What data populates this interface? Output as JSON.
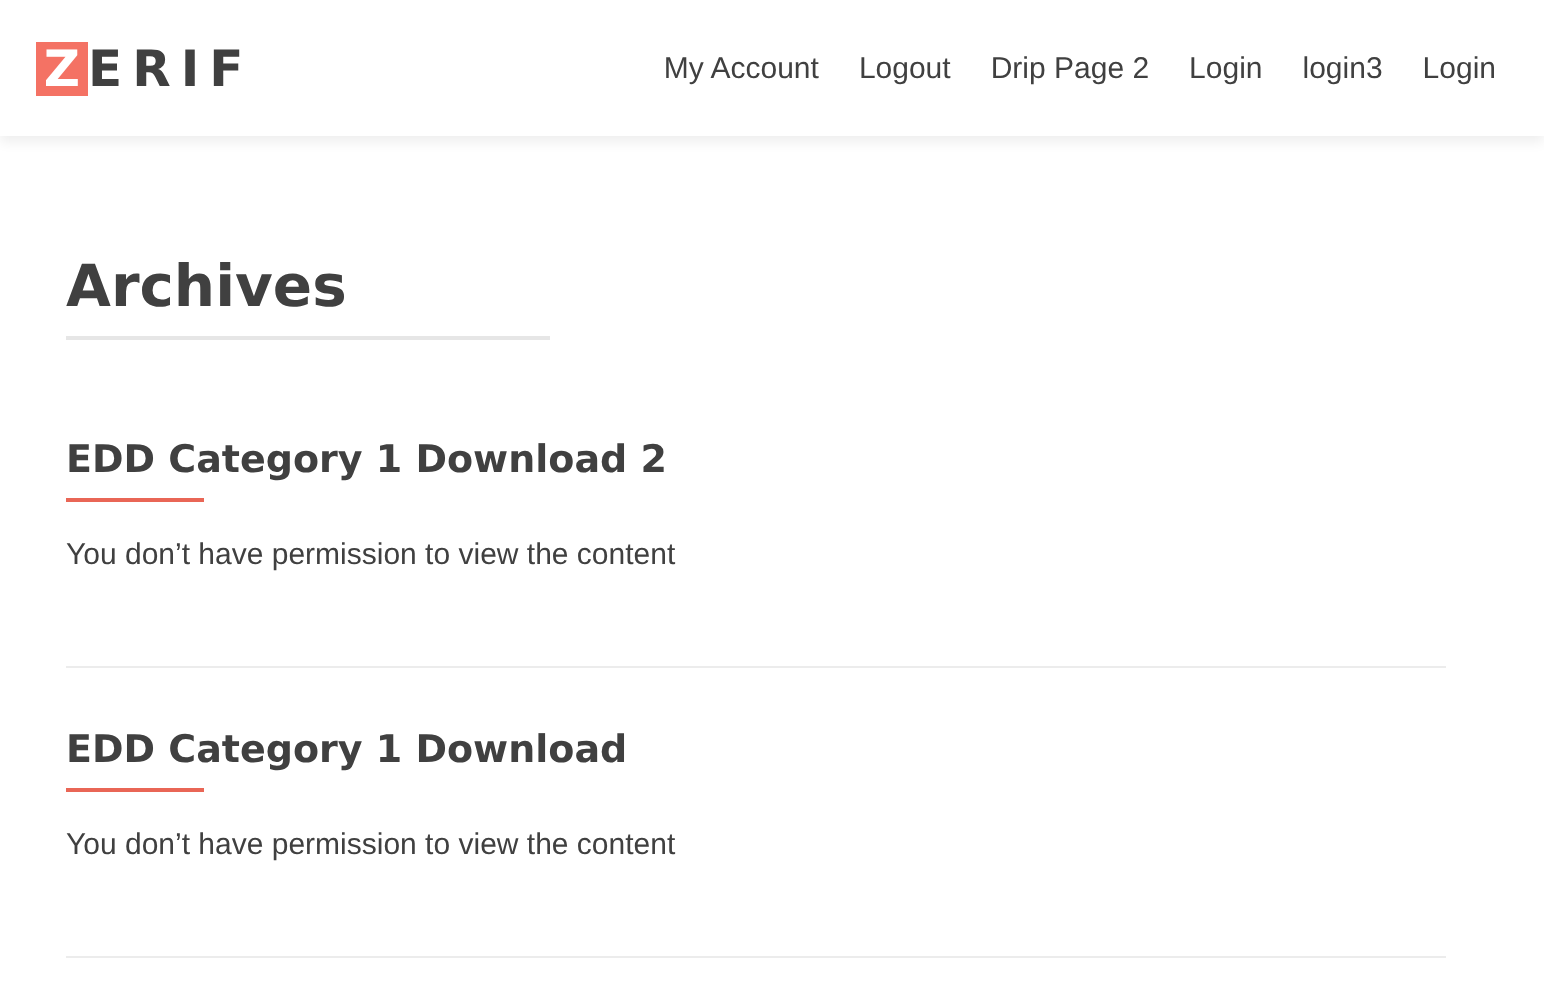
{
  "logo": "ZERIF",
  "nav": [
    {
      "label": "My Account"
    },
    {
      "label": "Logout"
    },
    {
      "label": "Drip Page 2"
    },
    {
      "label": "Login"
    },
    {
      "label": "login3"
    },
    {
      "label": "Login"
    }
  ],
  "page_title": "Archives",
  "posts": [
    {
      "title": "EDD Category 1 Download 2",
      "excerpt": "You don’t have permission to view the content"
    },
    {
      "title": "EDD Category 1 Download",
      "excerpt": "You don’t have permission to view the content"
    }
  ]
}
